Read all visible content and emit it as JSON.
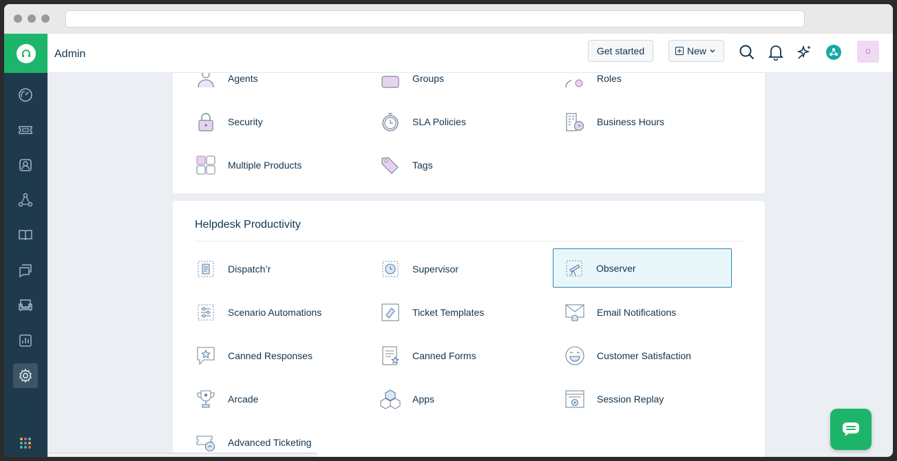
{
  "app": {
    "title": "Admin"
  },
  "header": {
    "get_started_label": "Get started",
    "new_label": "New",
    "avatar_initial": "D"
  },
  "sidebar": {
    "items": [
      {
        "name": "dashboard"
      },
      {
        "name": "tickets"
      },
      {
        "name": "contacts"
      },
      {
        "name": "groups"
      },
      {
        "name": "solutions"
      },
      {
        "name": "forums"
      },
      {
        "name": "assets"
      },
      {
        "name": "reports"
      },
      {
        "name": "admin",
        "active": true
      }
    ]
  },
  "team_section": {
    "items": [
      {
        "label": "Agents",
        "icon": "agent-icon"
      },
      {
        "label": "Groups",
        "icon": "groups-icon"
      },
      {
        "label": "Roles",
        "icon": "roles-icon"
      },
      {
        "label": "Security",
        "icon": "lock-icon"
      },
      {
        "label": "SLA Policies",
        "icon": "stopwatch-icon"
      },
      {
        "label": "Business Hours",
        "icon": "building-clock-icon"
      },
      {
        "label": "Multiple Products",
        "icon": "products-icon"
      },
      {
        "label": "Tags",
        "icon": "tags-icon"
      }
    ]
  },
  "productivity_section": {
    "title": "Helpdesk Productivity",
    "items": [
      {
        "label": "Dispatch’r",
        "icon": "dispatcher-icon"
      },
      {
        "label": "Supervisor",
        "icon": "supervisor-icon"
      },
      {
        "label": "Observer",
        "icon": "telescope-icon",
        "selected": true
      },
      {
        "label": "Scenario Automations",
        "icon": "automation-icon"
      },
      {
        "label": "Ticket Templates",
        "icon": "ticket-template-icon"
      },
      {
        "label": "Email Notifications",
        "icon": "email-bell-icon"
      },
      {
        "label": "Canned Responses",
        "icon": "canned-response-icon"
      },
      {
        "label": "Canned Forms",
        "icon": "canned-form-icon"
      },
      {
        "label": "Customer Satisfaction",
        "icon": "smiley-icon"
      },
      {
        "label": "Arcade",
        "icon": "trophy-icon"
      },
      {
        "label": "Apps",
        "icon": "cubes-icon"
      },
      {
        "label": "Session Replay",
        "icon": "session-replay-icon"
      },
      {
        "label": "Advanced Ticketing",
        "icon": "advanced-ticketing-icon"
      }
    ]
  },
  "colors": {
    "brand": "#1db56a",
    "sidebar": "#1f3a4d",
    "selected_border": "#2c84b8",
    "icon_purple": "#d7b9e6"
  }
}
